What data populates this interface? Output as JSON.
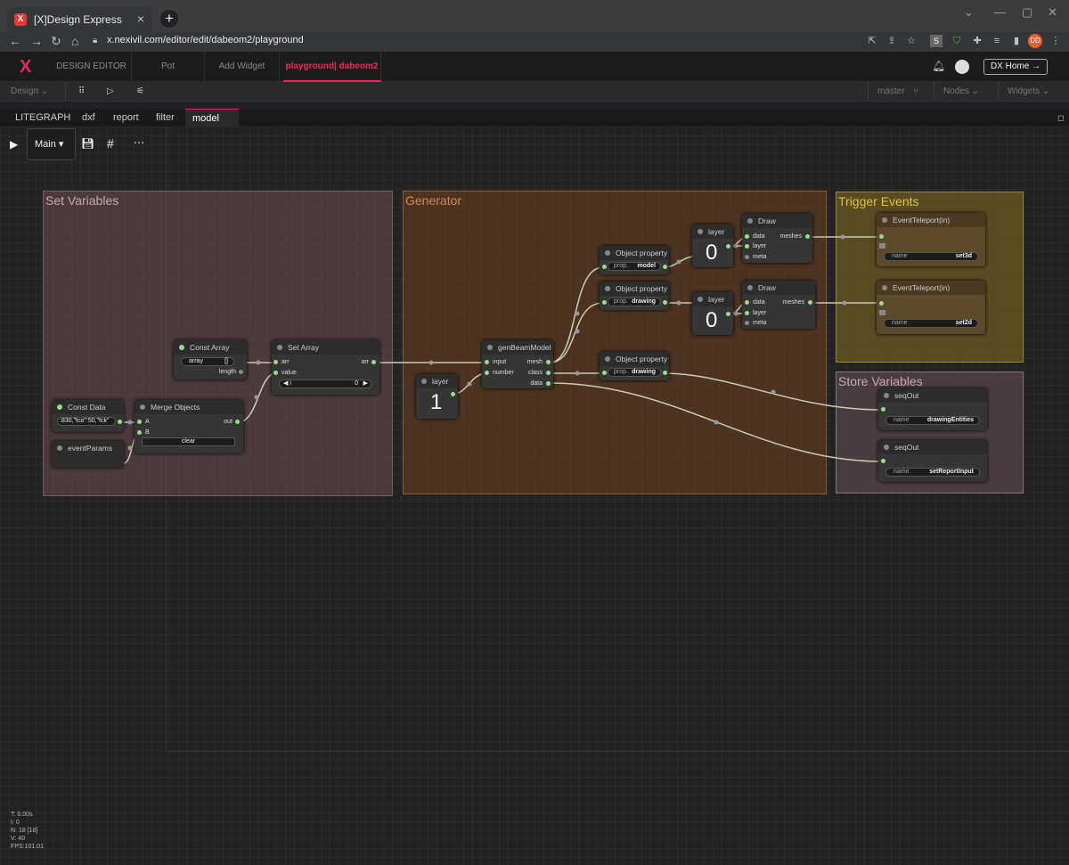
{
  "browser": {
    "tab_title": "[X]Design Express",
    "url": "x.nexivil.com/editor/edit/dabeom2/playground",
    "profile_initials": "DD"
  },
  "app": {
    "logo": "X",
    "tabs": [
      {
        "label": "DESIGN EDITOR"
      },
      {
        "label": "Pot"
      },
      {
        "label": "Add Widget"
      },
      {
        "label": "playground| dabeom2"
      }
    ],
    "home_button": "DX Home →"
  },
  "subbar": {
    "design": "Design ⌄",
    "branch": "master",
    "nodes": "Nodes ⌄",
    "widgets": "Widgets ⌄"
  },
  "graph_tabs": [
    "LITEGRAPH",
    "dxf",
    "report",
    "filter",
    "model",
    "X"
  ],
  "controls": {
    "main": "Main ▾"
  },
  "groups": {
    "set_variables": "Set Variables",
    "generator": "Generator",
    "trigger_events": "Trigger Events",
    "store_variables": "Store Variables"
  },
  "nodes": {
    "const_array": {
      "title": "Const Array",
      "widget": "array",
      "widget_value": "[]",
      "out": "length"
    },
    "set_array": {
      "title": "Set Array",
      "in1": "arr",
      "in2": "value",
      "out": "arr",
      "idx_label": "i",
      "idx_value": "0"
    },
    "const_data": {
      "title": "Const Data",
      "widget": ":830,\"fco\":50,\"fck\""
    },
    "merge_objects": {
      "title": "Merge Objects",
      "in1": "A",
      "in2": "B",
      "out": "out",
      "button": "clear"
    },
    "event_params": {
      "title": "eventParams"
    },
    "layer1": {
      "title": "layer",
      "value": "1"
    },
    "gen_beam": {
      "title": "genBeamModel",
      "in1": "input",
      "in2": "number",
      "out1": "mesh",
      "out2": "class",
      "out3": "data"
    },
    "obj_prop1": {
      "title": "Object property",
      "label": "prop.",
      "value": "model"
    },
    "obj_prop2": {
      "title": "Object property",
      "label": "prop.",
      "value": "drawing"
    },
    "obj_prop3": {
      "title": "Object property",
      "label": "prop.",
      "value": "drawing"
    },
    "layer_top": {
      "title": "layer",
      "value": "0"
    },
    "layer_mid": {
      "title": "layer",
      "value": "0"
    },
    "draw1": {
      "title": "Draw",
      "in1": "data",
      "in2": "layer",
      "in3": "meta",
      "out": "meshes"
    },
    "draw2": {
      "title": "Draw",
      "in1": "data",
      "in2": "layer",
      "in3": "meta",
      "out": "meshes"
    },
    "teleport1": {
      "title": "EventTeleport(in)",
      "label": "name",
      "value": "set3d"
    },
    "teleport2": {
      "title": "EventTeleport(in)",
      "label": "name",
      "value": "set2d"
    },
    "seqout1": {
      "title": "seqOut",
      "label": "name",
      "value": "drawingEntities"
    },
    "seqout2": {
      "title": "seqOut",
      "label": "name",
      "value": "setReportInput"
    }
  },
  "stats": [
    "T: 0.00s",
    "I: 0",
    "N: 18 [18]",
    "V: 40",
    "FPS:101.01"
  ],
  "colors": {
    "accent": "#e8285a",
    "port": "#9cd98c"
  }
}
